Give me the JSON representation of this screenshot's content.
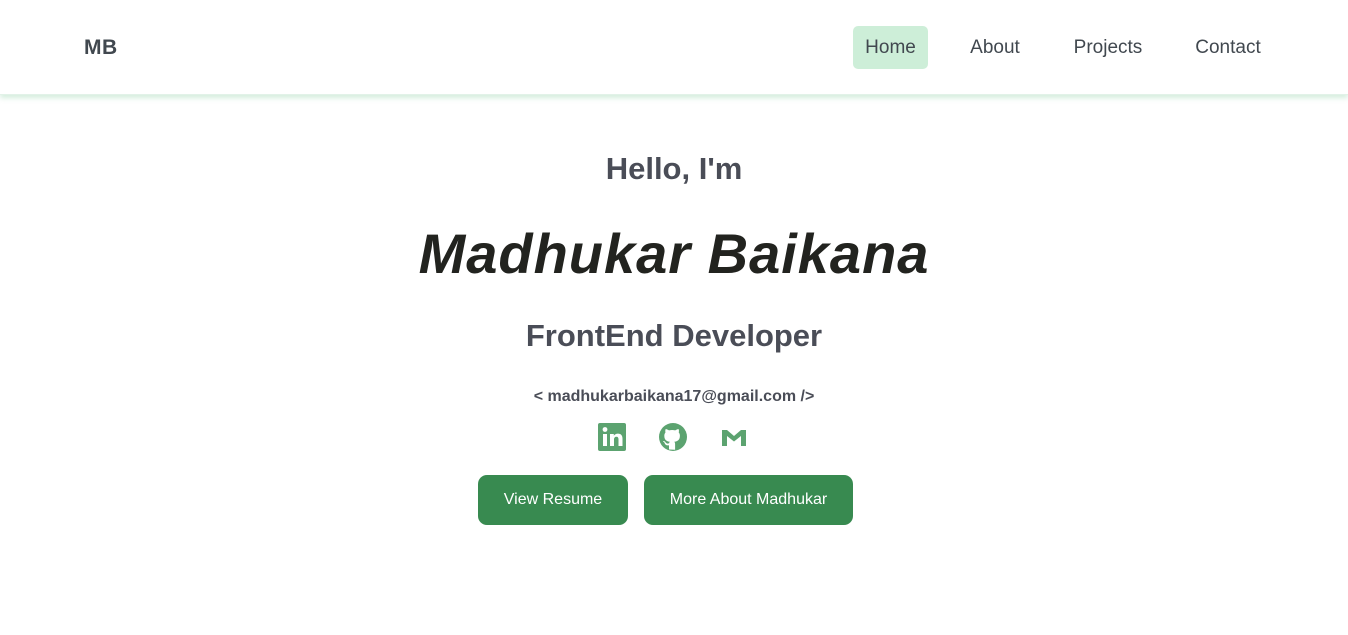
{
  "nav": {
    "brand": "MB",
    "links": [
      {
        "label": "Home",
        "active": true
      },
      {
        "label": "About",
        "active": false
      },
      {
        "label": "Projects",
        "active": false
      },
      {
        "label": "Contact",
        "active": false
      }
    ]
  },
  "hero": {
    "greeting": "Hello, I'm",
    "name": "Madhukar Baikana",
    "role": "FrontEnd Developer",
    "email": "< madhukarbaikana17@gmail.com />",
    "socials": [
      {
        "icon": "linkedin-icon"
      },
      {
        "icon": "github-icon"
      },
      {
        "icon": "gmail-icon"
      }
    ],
    "buttons": {
      "resume": "View Resume",
      "about": "More About Madhukar"
    }
  },
  "colors": {
    "accent": "#388a50",
    "icon": "#5ca370",
    "active_tab_bg": "#cdeed8",
    "text_dark": "#22231f",
    "text_muted": "#4a4d57"
  }
}
